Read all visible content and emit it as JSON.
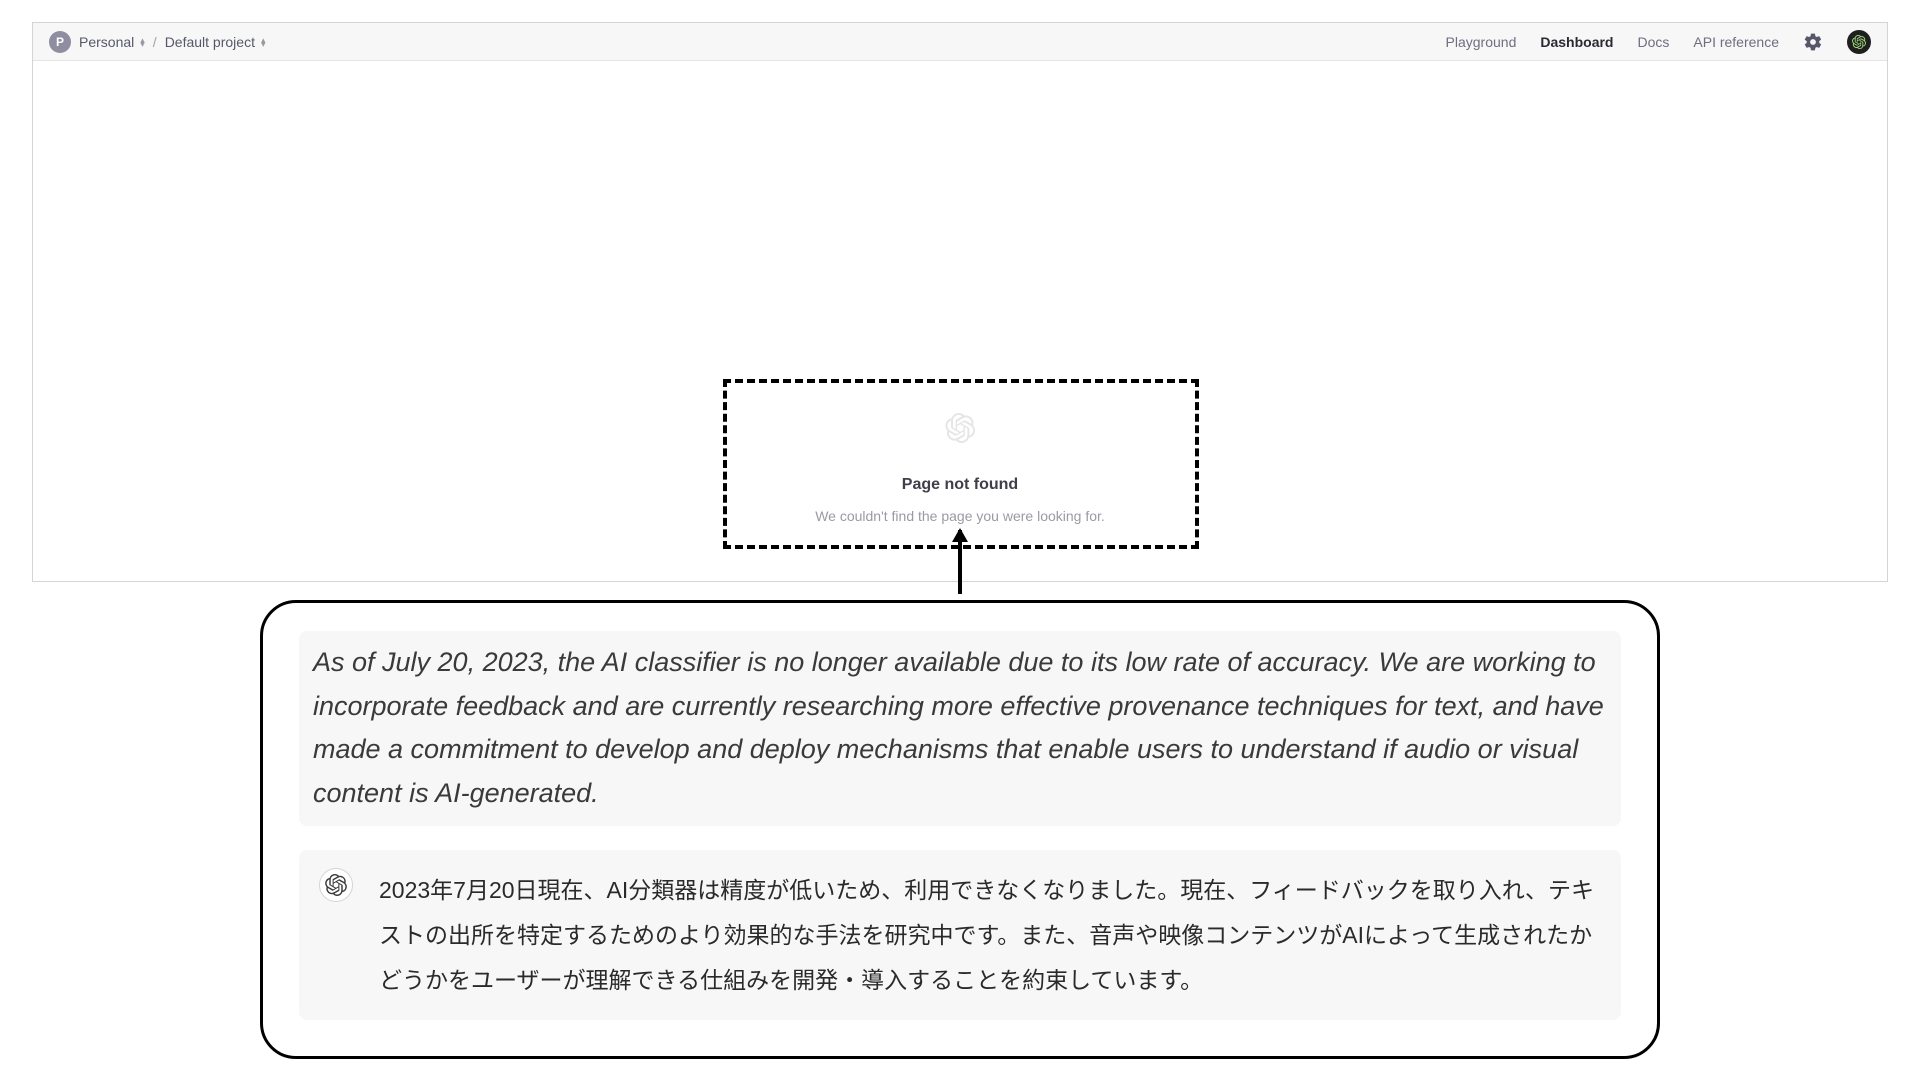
{
  "breadcrumb": {
    "org_initial": "P",
    "org": "Personal",
    "project": "Default project"
  },
  "nav": {
    "playground": "Playground",
    "dashboard": "Dashboard",
    "docs": "Docs",
    "api_reference": "API reference"
  },
  "notfound": {
    "title": "Page not found",
    "subtitle": "We couldn't find the page you were looking for."
  },
  "callout": {
    "english": "As of July 20, 2023, the AI classifier is no longer available due to its low rate of accuracy. We are working to incorporate feedback and are currently researching more effective provenance techniques for text, and have made a commitment to develop and deploy mechanisms that enable users to understand if audio or visual content is AI-generated.",
    "japanese": "2023年7月20日現在、AI分類器は精度が低いため、利用できなくなりました。現在、フィードバックを取り入れ、テキストの出所を特定するためのより効果的な手法を研究中です。また、音声や映像コンテンツがAIによって生成されたかどうかをユーザーが理解できる仕組みを開発・導入することを約束しています。"
  }
}
